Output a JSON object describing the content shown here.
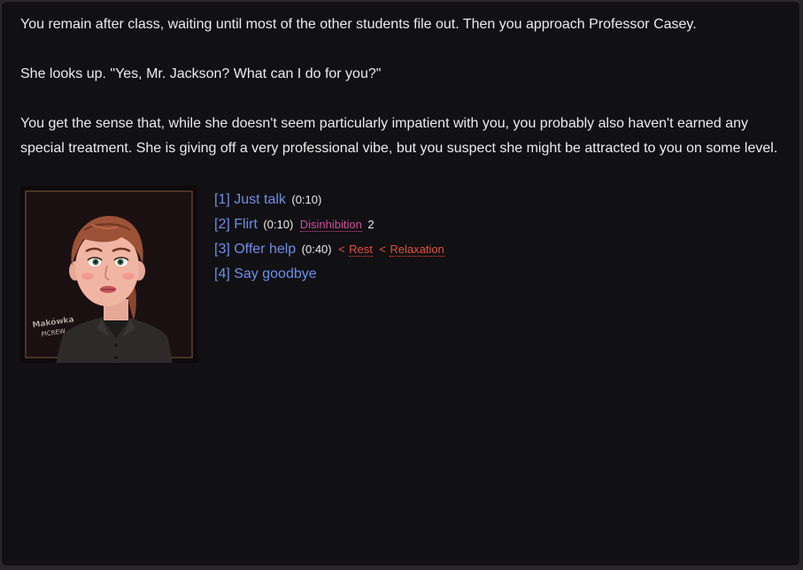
{
  "narrative": {
    "p1": "You remain after class, waiting until most of the other students file out. Then you approach Professor Casey.",
    "p2": "She looks up. \"Yes, Mr. Jackson? What can I do for you?\"",
    "p3": "You get the sense that, while she doesn't seem particularly impatient with you, you probably also haven't earned any special treatment. She is giving off a very professional vibe, but you suspect she might be attracted to you on some level."
  },
  "portrait": {
    "watermark_line1": "Makówka",
    "watermark_line2": "PICREW"
  },
  "choices": [
    {
      "label": "[1] Just talk",
      "time": "(0:10)"
    },
    {
      "label": "[2] Flirt",
      "time": "(0:10)",
      "stat": "Disinhibition",
      "stat_value": "2"
    },
    {
      "label": "[3] Offer help",
      "time": "(0:40)",
      "lt1": "<",
      "req1": "Rest",
      "lt2": "<",
      "req2": "Relaxation"
    },
    {
      "label": "[4] Say goodbye"
    }
  ],
  "colors": {
    "link": "#6b8fe8",
    "stat_pink": "#d24c9a",
    "stat_red": "#e0503c",
    "background": "#111013"
  }
}
